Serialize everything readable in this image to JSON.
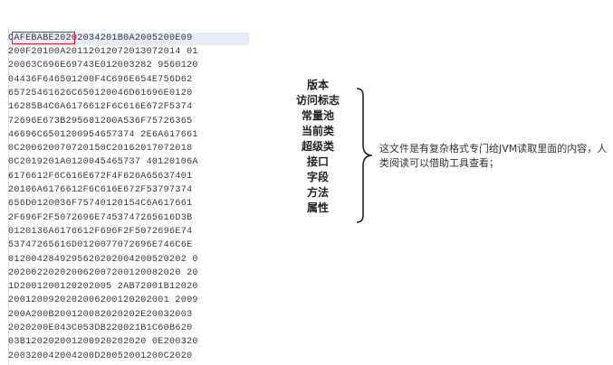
{
  "hex_view": {
    "magic": "CAFEBABE",
    "first_line_rest": "20202034201B0A2005200E09",
    "lines": [
      "200F20100A20112012072013072014 01",
      "20063C696E69743E012003282 9560120",
      "04436F646501200F4C696E654E756D62",
      "65725461626C650120046D61696E0120",
      "16285B4C6A6176612F6C616E672F5374",
      "72696E673B295601200A536F75726365",
      "46696C6501200954657374 2E6A617661",
      "0C200620070720150C20162017072018",
      "0C2019201A0120045465737 40120106A",
      "6176612F6C616E672F4F626A65637401",
      "20106A6176612F6C616E672F53797374",
      "656D0120036F75740120154C6A617661",
      "2F696F2F5072696E7453747265616D3B",
      "0120136A6176612F696F2F5072696E74",
      "53747265616D0120077072696E746C6E",
      "0120042849295620202004200520202 0",
      "202002202020062007200120082020 20",
      "1D2001200120202005 2AB72001B12020",
      "2001200920202006200120202001 2009",
      "200A200B200120082020202E20032003",
      "2020200E043C053DB220021B1C60B620",
      "03B120202001200920202020 0E200320",
      "200320042004200D20052001200C2020"
    ]
  },
  "structure_labels": [
    "版本",
    "访问标志",
    "常量池",
    "当前类",
    "超级类",
    "接口",
    "字段",
    "方法",
    "属性"
  ],
  "note": "这文件是有复杂格式专门给JVM读取里面的内容，人类阅读可以借助工具查看；",
  "colors": {
    "highlight_box": "#e0202a",
    "first_row_bg": "#e7ebf7",
    "brace": "#222222"
  }
}
